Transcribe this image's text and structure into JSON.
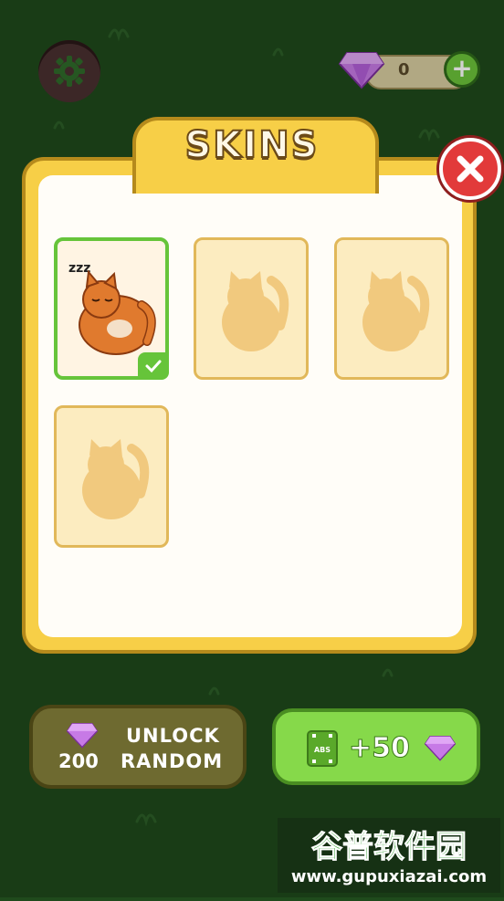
{
  "header": {
    "gem_count": "0",
    "add_label": "+"
  },
  "panel": {
    "title": "SKINS",
    "close_label": "×"
  },
  "skins": [
    {
      "name": "sleeping-orange-cat",
      "unlocked": true,
      "selected": true,
      "zzz": "zzz"
    },
    {
      "name": "locked-skin",
      "unlocked": false,
      "selected": false
    },
    {
      "name": "locked-skin",
      "unlocked": false,
      "selected": false
    },
    {
      "name": "locked-skin",
      "unlocked": false,
      "selected": false
    }
  ],
  "footer": {
    "unlock_price": "200",
    "unlock_line1": "UNLOCK",
    "unlock_line2": "RANDOM",
    "ads_label": "ABS",
    "ads_reward": "+50"
  },
  "watermark": {
    "line1": "谷普软件园",
    "line2": "www.gupuxiazai.com"
  },
  "colors": {
    "background": "#1f4a1c",
    "panel_yellow": "#f7cf47",
    "gem_purple": "#c77ae6",
    "green_button": "#86d94a",
    "close_red": "#e23a3a"
  }
}
